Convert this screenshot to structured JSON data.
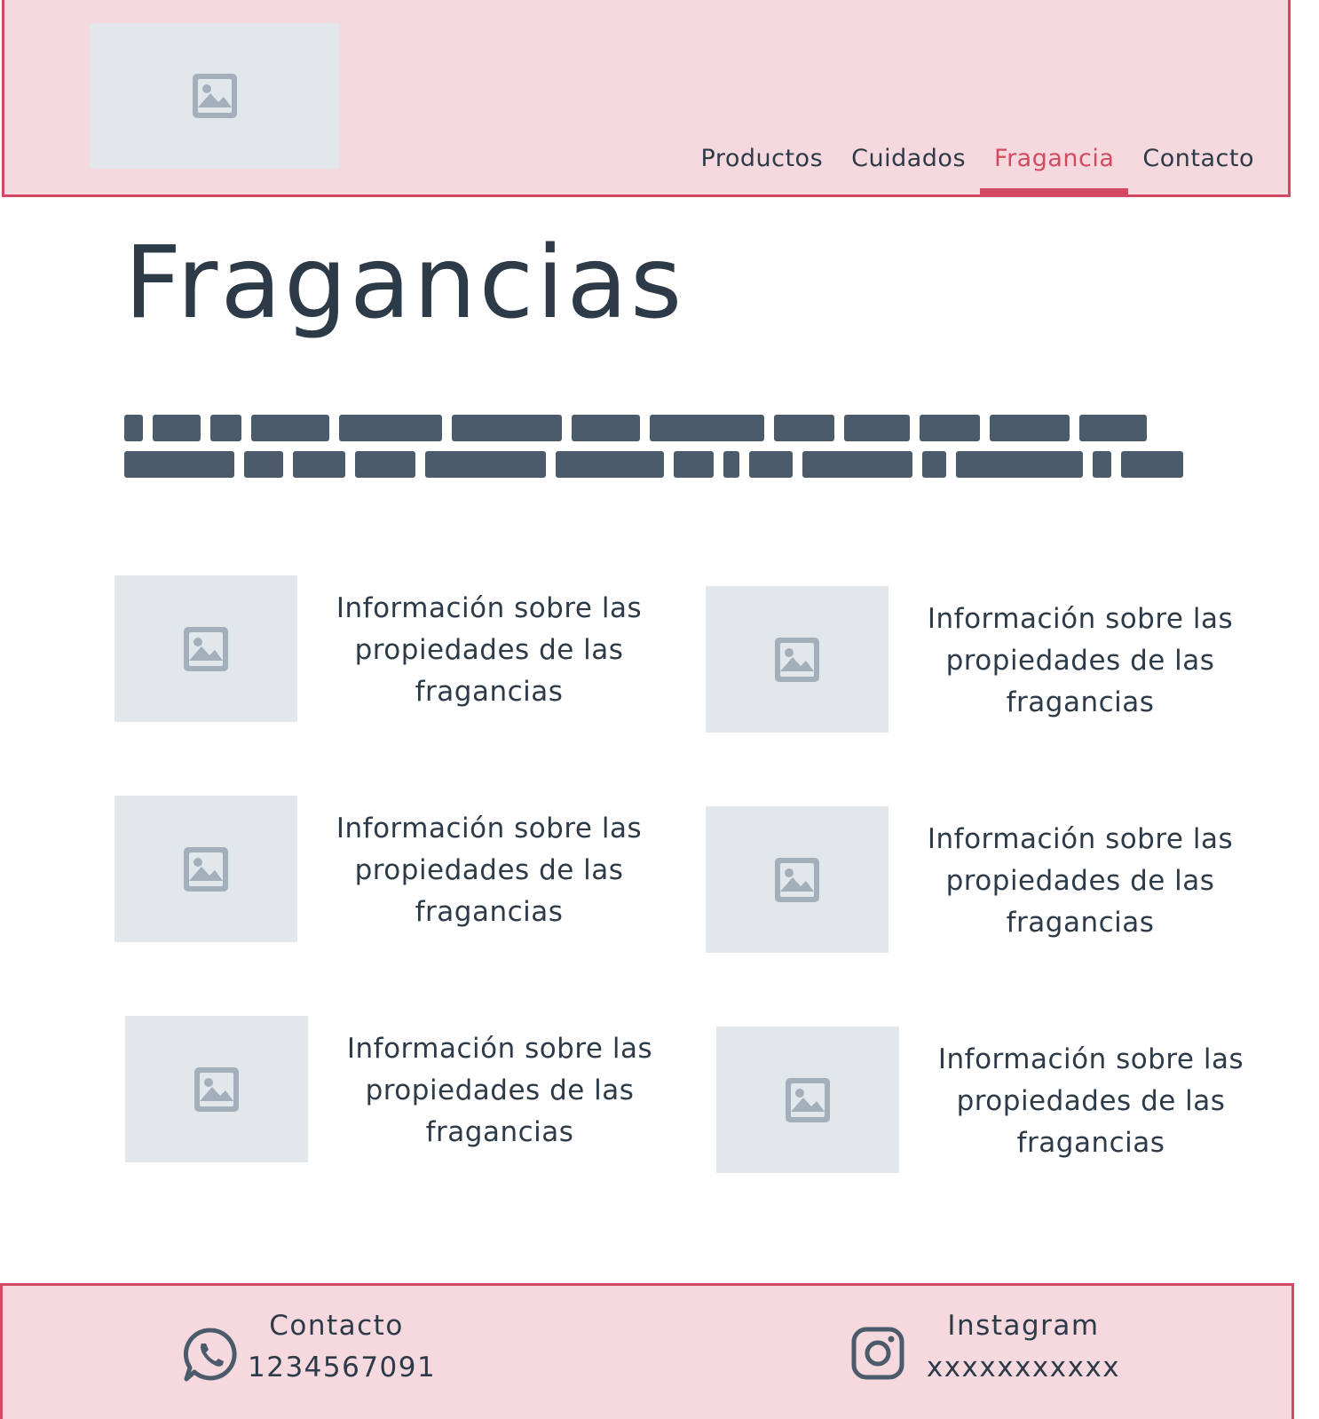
{
  "header": {
    "logo_icon": "image-placeholder-icon",
    "nav": [
      {
        "label": "Productos",
        "active": false
      },
      {
        "label": "Cuidados",
        "active": false
      },
      {
        "label": "Fragancia",
        "active": true
      },
      {
        "label": "Contacto",
        "active": false
      }
    ]
  },
  "main": {
    "title": "Fragancias",
    "cards": [
      {
        "text": "Información sobre las propiedades de las fragancias"
      },
      {
        "text": "Información sobre las propiedades de las fragancias"
      },
      {
        "text": "Información sobre las propiedades de las fragancias"
      },
      {
        "text": "Información sobre las propiedades de las fragancias"
      },
      {
        "text": "Información sobre las propiedades de las fragancias"
      },
      {
        "text": "Información sobre las propiedades de las fragancias"
      }
    ]
  },
  "footer": {
    "contact": {
      "icon": "whatsapp-icon",
      "label": "Contacto",
      "value": "1234567091"
    },
    "instagram": {
      "icon": "instagram-icon",
      "label": "Instagram",
      "value": "xxxxxxxxxxx"
    }
  },
  "colors": {
    "accent": "#d14a62",
    "header_bg": "#f6d9de",
    "text": "#2d3a48",
    "placeholder": "#e2e7eb",
    "placeholder_icon": "#a3b0bc"
  }
}
